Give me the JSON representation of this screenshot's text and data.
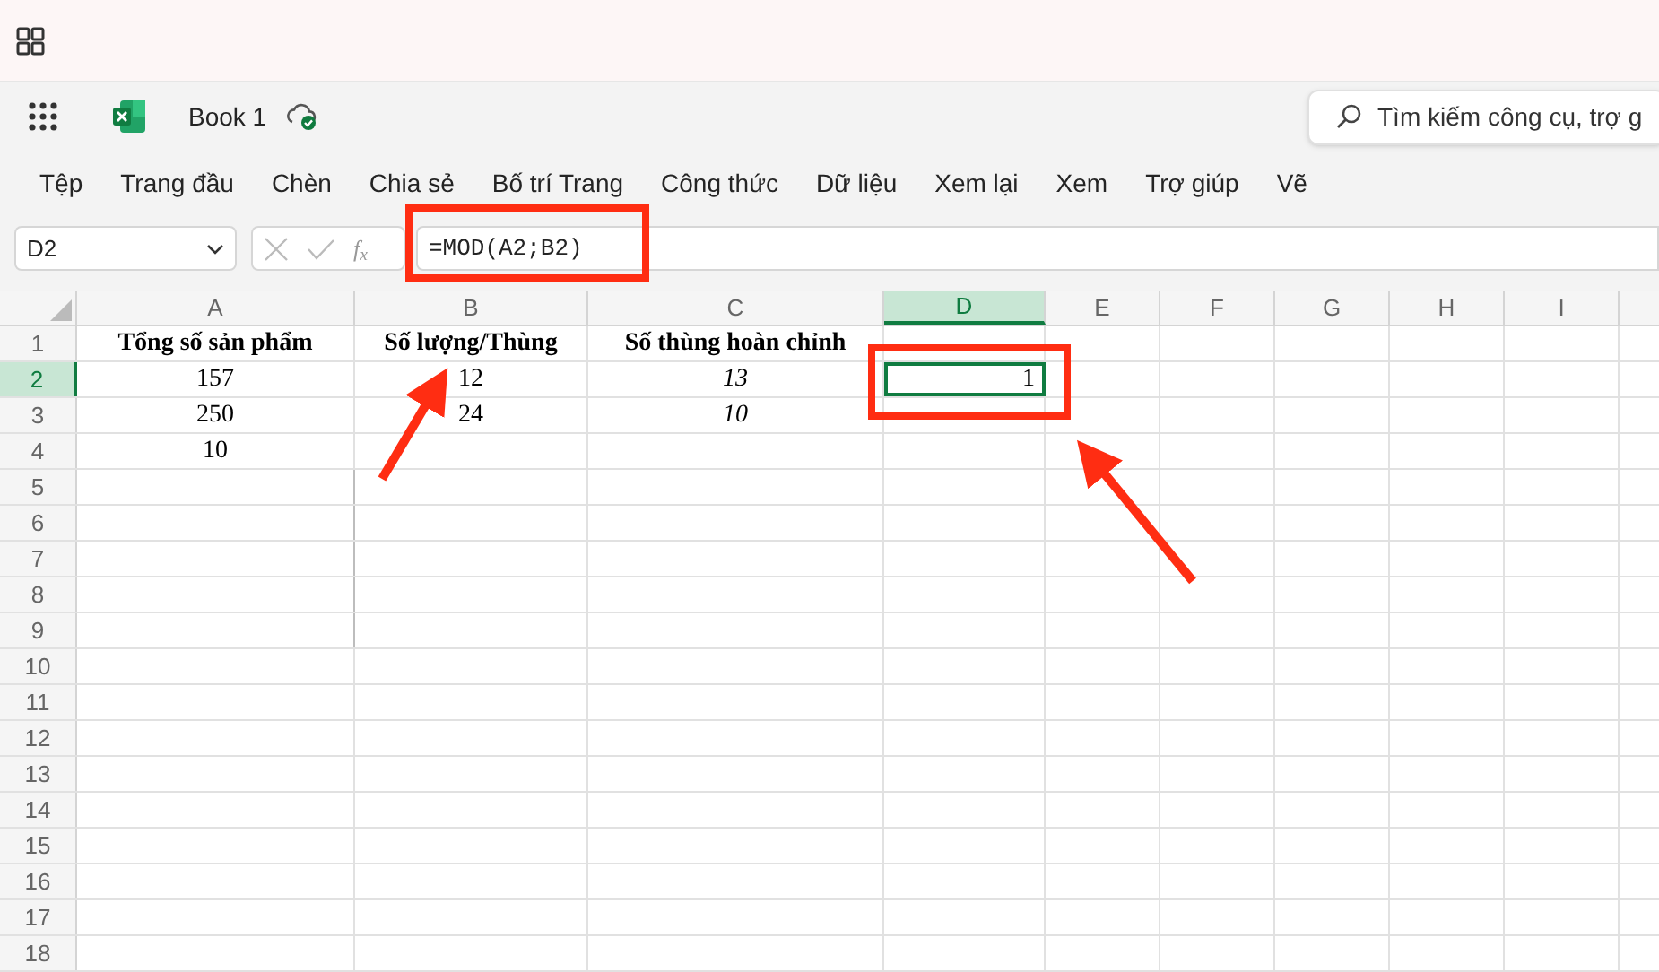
{
  "title_bar": {
    "document": "Book 1"
  },
  "search": {
    "placeholder": "Tìm kiếm công cụ, trợ g"
  },
  "menu": [
    {
      "label": "Tệp"
    },
    {
      "label": "Trang đầu"
    },
    {
      "label": "Chèn"
    },
    {
      "label": "Chia sẻ"
    },
    {
      "label": "Bố trí Trang"
    },
    {
      "label": "Công thức"
    },
    {
      "label": "Dữ liệu"
    },
    {
      "label": "Xem lại"
    },
    {
      "label": "Xem"
    },
    {
      "label": "Trợ giúp"
    },
    {
      "label": "Vẽ"
    }
  ],
  "formula_bar": {
    "name_box": "D2",
    "fx": "f$_{x}$",
    "formula": "=MOD(A2;B2)"
  },
  "columns": [
    {
      "label": "A",
      "selected": false
    },
    {
      "label": "B",
      "selected": false
    },
    {
      "label": "C",
      "selected": false
    },
    {
      "label": "D",
      "selected": true
    },
    {
      "label": "E",
      "selected": false
    },
    {
      "label": "F",
      "selected": false
    },
    {
      "label": "G",
      "selected": false
    },
    {
      "label": "H",
      "selected": false
    },
    {
      "label": "I",
      "selected": false
    }
  ],
  "rows": [
    {
      "label": "1",
      "selected": false,
      "cells": {
        "col_a": {
          "text": "Tổng số sản phẩm",
          "kind": "heading"
        },
        "col_b": {
          "text": "Số lượng/Thùng",
          "kind": "heading"
        },
        "col_c": {
          "text": "Số thùng hoàn chỉnh",
          "kind": "heading"
        }
      }
    },
    {
      "label": "2",
      "selected": true,
      "cells": {
        "col_a": {
          "text": "157",
          "kind": "center"
        },
        "col_b": {
          "text": "12",
          "kind": "center"
        },
        "col_c": {
          "text": "13",
          "kind": "italic"
        },
        "col_d": {
          "text": "1",
          "kind": "right",
          "selected": true
        }
      }
    },
    {
      "label": "3",
      "selected": false,
      "cells": {
        "col_a": {
          "text": "250",
          "kind": "center"
        },
        "col_b": {
          "text": "24",
          "kind": "center"
        },
        "col_c": {
          "text": "10",
          "kind": "italic"
        }
      }
    },
    {
      "label": "4",
      "selected": false,
      "cells": {
        "col_a": {
          "text": "10",
          "kind": "center"
        }
      }
    },
    {
      "label": "5",
      "selected": false
    },
    {
      "label": "6",
      "selected": false
    },
    {
      "label": "7",
      "selected": false
    },
    {
      "label": "8",
      "selected": false
    },
    {
      "label": "9",
      "selected": false
    },
    {
      "label": "10",
      "selected": false
    },
    {
      "label": "11",
      "selected": false
    },
    {
      "label": "12",
      "selected": false
    },
    {
      "label": "13",
      "selected": false
    },
    {
      "label": "14",
      "selected": false
    },
    {
      "label": "15",
      "selected": false
    },
    {
      "label": "16",
      "selected": false
    },
    {
      "label": "17",
      "selected": false
    },
    {
      "label": "18",
      "selected": false
    }
  ]
}
